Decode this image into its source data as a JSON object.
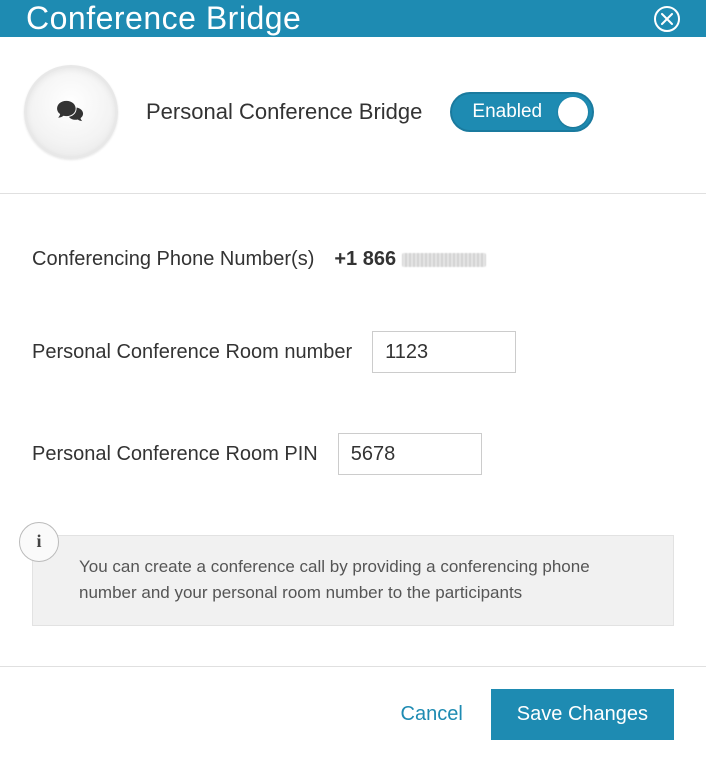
{
  "header": {
    "title": "Conference Bridge"
  },
  "feature": {
    "name": "Personal Conference Bridge",
    "toggle_label": "Enabled",
    "toggle_state": true
  },
  "form": {
    "phone_label": "Conferencing Phone Number(s)",
    "phone_value_prefix": "+1 866",
    "room_number_label": "Personal Conference Room number",
    "room_number_value": "1123",
    "room_pin_label": "Personal Conference Room PIN",
    "room_pin_value": "5678"
  },
  "info": {
    "icon_glyph": "i",
    "text": "You can create a conference call by providing a conferencing phone number and your personal room number to the participants"
  },
  "footer": {
    "cancel_label": "Cancel",
    "save_label": "Save Changes"
  }
}
